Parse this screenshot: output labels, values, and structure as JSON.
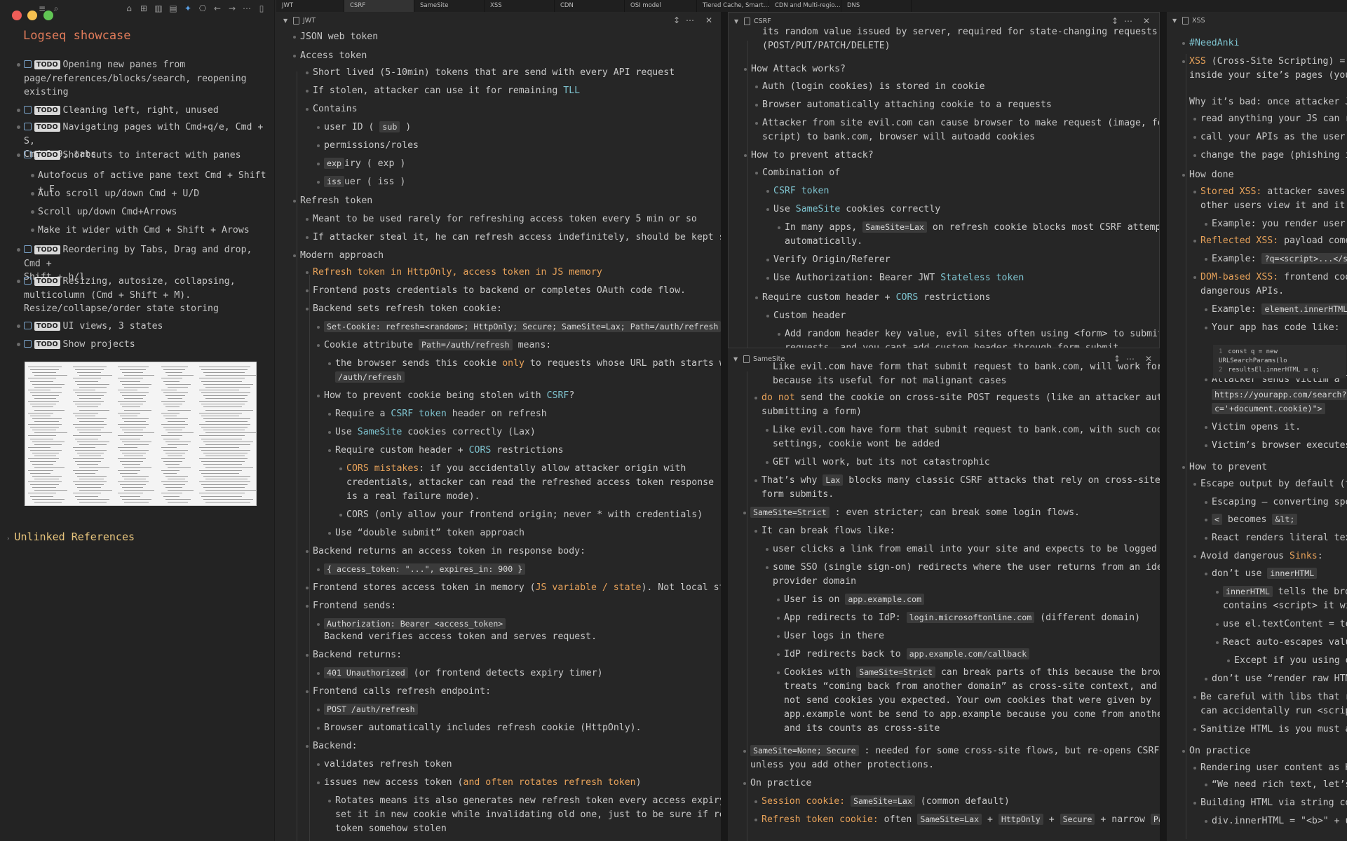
{
  "window": {
    "traffic": [
      "close",
      "minimize",
      "zoom"
    ]
  },
  "sidebar": {
    "title": "Logseq showcase",
    "todo_label": "TODO",
    "items": [
      {
        "l1": "Opening new panes from",
        "l2": "page/references/blocks/search, reopening",
        "l3": "existing",
        "todo": true
      },
      {
        "l1": "Cleaning left, right, unused",
        "todo": true
      },
      {
        "l1": "Navigating pages with Cmd+q/e, Cmd + S,",
        "l2": "Cmd+1-9, tabs",
        "todo": true
      },
      {
        "l1": "Shortcuts to interact with panes",
        "todo": true
      },
      {
        "l1": "Autofocus of active pane text Cmd + Shift + F",
        "todo": false
      },
      {
        "l1": "Auto scroll up/down Cmd + U/D",
        "todo": false
      },
      {
        "l1": "Scroll up/down Cmd+Arrows",
        "todo": false
      },
      {
        "l1": "Make it wider with Cmd + Shift + Arows",
        "todo": false
      },
      {
        "l1": "Reordering by Tabs, Drag and drop, Cmd +",
        "l2": "Shift + h/l",
        "todo": true
      },
      {
        "l1": "Resizing, autosize, collapsing,",
        "l2": "multicolumn (Cmd + Shift + M).",
        "l3": "Resize/collapse/order state storing",
        "todo": true
      },
      {
        "l1": "UI views, 3 states",
        "todo": true
      },
      {
        "l1": "Show projects",
        "todo": true
      }
    ],
    "unlinked": "Unlinked References"
  },
  "tabs": [
    "JWT",
    "CSRF",
    "SameSite",
    "XSS",
    "CDN",
    "OSI model",
    "Tiered Cache, Smart...",
    "CDN and Multi-regio...",
    "DNS"
  ],
  "panes": {
    "jwt": {
      "title": "JWT"
    },
    "csrf": {
      "title": "CSRF"
    },
    "samesite": {
      "title": "SameSite"
    },
    "xss": {
      "title": "XSS"
    }
  },
  "jwt_rows": [
    "JSON web token",
    "Access token",
    "Short lived (5-10min) tokens that are send with every API request",
    "If stolen, attacker can use it for remaining TLL",
    "Contains",
    "user ID ( sub )",
    "permissions/roles",
    "expiry ( exp )",
    "issuer ( iss )",
    "Refresh token",
    "Meant to be used rarely for refreshing access token every 5 min or so",
    "If attacker steal it, he can refresh access indefinitely, should be kept secret",
    "Modern approach",
    "Refresh token in HttpOnly, access token in JS memory",
    "Frontend posts credentials to backend or completes OAuth code flow.",
    "Backend sets refresh token cookie:",
    "Set-Cookie: refresh=<random>; HttpOnly; Secure; SameSite=Lax; Path=/auth/refresh",
    "Cookie attribute Path=/auth/refresh means:",
    "the browser sends this cookie only to requests whose URL path starts with",
    "/auth/refresh",
    "How to prevent cookie being stolen with CSRF?",
    "Require a CSRF token header on refresh",
    "Use SameSite cookies correctly (Lax)",
    "Require custom header + CORS restrictions",
    "CORS mistakes: if you accidentally allow attacker origin with",
    "credentials, attacker can read the refreshed access token response (this",
    "is a real failure mode).",
    "CORS (only allow your frontend origin; never * with credentials)",
    "Use “double submit” token approach",
    "Backend returns an access token in response body:",
    "{ access_token: \"...\", expires_in: 900 }",
    "Frontend stores access token in memory (JS variable / state). Not local storage",
    "Frontend sends:",
    "Authorization: Bearer <access_token>",
    "Backend verifies access token and serves request.",
    "Backend returns:",
    "401 Unauthorized (or frontend detects expiry timer)",
    "Frontend calls refresh endpoint:",
    "POST /auth/refresh",
    "Browser automatically includes refresh cookie (HttpOnly).",
    "Backend:",
    "validates refresh token",
    "issues new access token (and often rotates refresh token)",
    "Rotates means its also generates new refresh token every access expiry, and",
    "set it in new cookie while invalidating old one, just to be sure if refresh",
    "token somehow stolen"
  ],
  "csrf_rows": [
    "its random value issued by server, required for state-changing requests",
    "(POST/PUT/PATCH/DELETE)",
    "How Attack works?",
    "Auth (login cookies) is stored in cookie",
    "Browser automatically attaching cookie to a requests",
    "Attacker from site evil.com can cause browser to make request (image, form,",
    "script) to bank.com, browser will autoadd cookies",
    "How to prevent attack?",
    "Combination of",
    "CSRF token",
    "Use SameSite cookies correctly",
    "In many apps, SameSite=Lax on refresh cookie blocks most CSRF attempts",
    "automatically.",
    "Verify Origin/Referer",
    "Use Authorization: Bearer JWT Stateless token",
    "Require custom header + CORS restrictions",
    "Custom header",
    "Add random header key value, evil sites often using <form> to submit",
    "requests, and you cant add custom header through form submit"
  ],
  "samesite_rows": [
    "Like evil.com have form that submit request to bank.com, will work for GET,",
    "because its useful for not malignant cases",
    "do not send the cookie on cross-site POST requests (like an attacker auto-",
    "submitting a form)",
    "Like evil.com have form that submit request to bank.com, with such cookie",
    "settings, cookie wont be added",
    "GET will work, but its not catastrophic",
    "That’s why Lax blocks many classic CSRF attacks that rely on cross-site POST",
    "form submits.",
    "SameSite=Strict : even stricter; can break some login flows.",
    "It can break flows like:",
    "user clicks a link from email into your site and expects to be logged in",
    "some SSO (single sign-on) redirects where the user returns from an identity",
    "provider domain",
    "User is on app.example.com",
    "App redirects to IdP: login.microsoftonline.com (different domain)",
    "User logs in there",
    "IdP redirects back to app.example.com/callback",
    "Cookies with SameSite=Strict can break parts of this because the browser",
    "treats “coming back from another domain” as cross-site context, and may",
    "not send cookies you expected. Your own cookies that were given by",
    "app.example wont be send to app.example because you come from another site",
    "and its counts as cross-site",
    "SameSite=None; Secure : needed for some cross-site flows, but re-opens CSRF risk",
    "unless you add other protections.",
    "On practice",
    "Session cookie: SameSite=Lax (common default)",
    "Refresh token cookie: often SameSite=Lax + HttpOnly + Secure + narrow Path"
  ],
  "xss_rows": [
    "#NeedAnki",
    "XSS (Cross-Site Scripting) = a b",
    "inside your site’s pages (your d",
    "Why it’s bad: once attacker JS r",
    "read anything your JS can read",
    "call your APIs as the user",
    "change the page (phishing ins",
    "How done",
    "Stored XSS: attacker saves pay",
    "other users view it and it run",
    "Example: you render user co",
    "Reflected XSS: payload comes f",
    "Example: ?q=<script>...</sc",
    "DOM-based XSS: frontend code",
    "dangerous APIs.",
    "Example: element.innerHTML =",
    "Your app has code like:",
    "Attacker sends victim a lin",
    "https://yourapp.com/search?",
    "c='+document.cookie)\">",
    "Victim opens it.",
    "Victim’s browser executes a",
    "How to prevent",
    "Escape output by default (tre",
    "Escaping – converting spec",
    "< becomes &lt;",
    "React renders literal text,",
    "Avoid dangerous Sinks:",
    "don’t use innerHTML",
    "innerHTML tells the brow",
    "contains <script> it wil",
    "use el.textContent = tex",
    "React auto-escapes value",
    "Except if you using da",
    "don’t use “render raw HTML”",
    "Be careful with libs that rend",
    "can accidentally run <script>",
    "Sanitize HTML is you must acce",
    "On practice",
    "Rendering user content as HTML",
    "“We need rich text, let’s r",
    "Building HTML via string conca",
    "div.innerHTML = \"<b>\" + use"
  ],
  "xss_code": [
    "const q = new URLSearchParams(lo",
    "resultsEl.innerHTML = q;"
  ]
}
